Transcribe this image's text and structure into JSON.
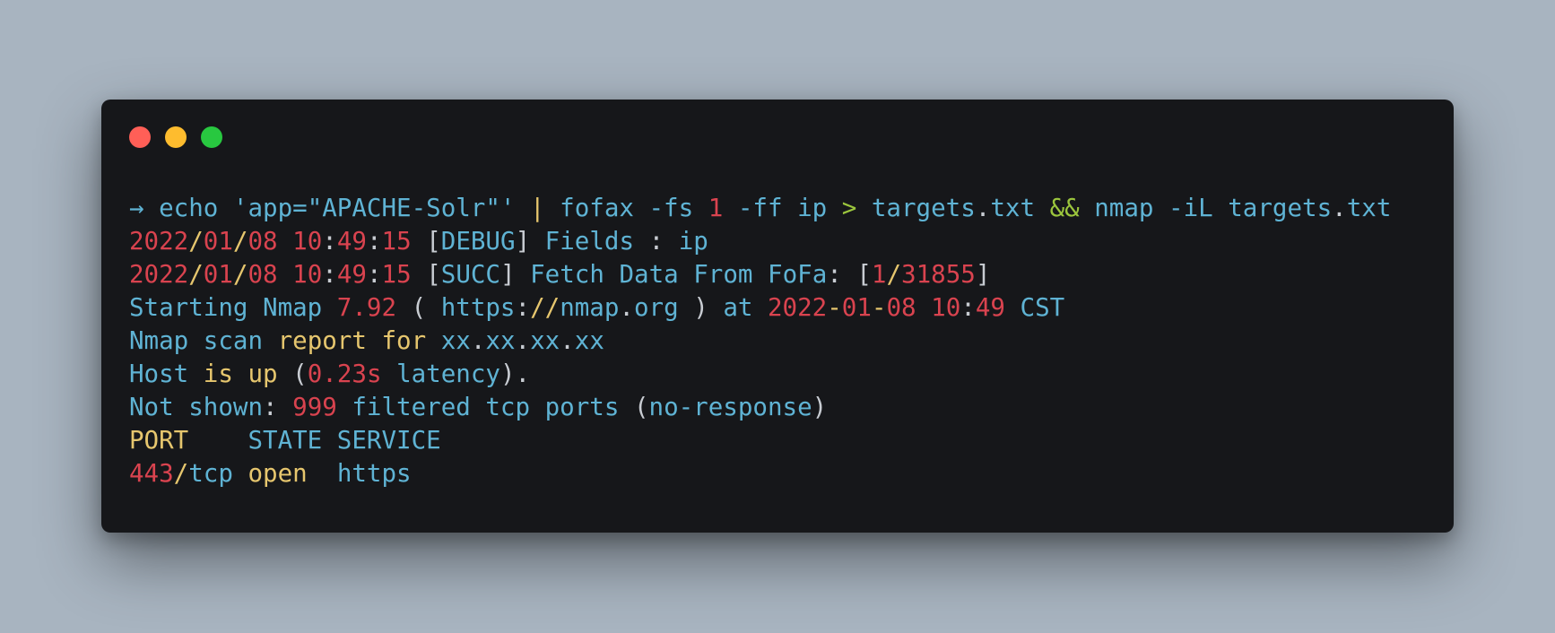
{
  "colors": {
    "blue": "#5fb3d4",
    "red": "#d9434f",
    "yellow": "#e6c66e",
    "white": "#c8ccd2",
    "green": "#9bc53d",
    "background": "#a8b4c0",
    "window": "#16171a"
  },
  "window_controls": {
    "close_icon": "red-dot",
    "minimize_icon": "yellow-dot",
    "maximize_icon": "green-dot"
  },
  "terminal": {
    "lines": [
      [
        {
          "t": "→",
          "c": "blue"
        },
        {
          "t": " echo ",
          "c": "blue"
        },
        {
          "t": "'app=\"APACHE-Solr\"'",
          "c": "blue"
        },
        {
          "t": " | ",
          "c": "yellow"
        },
        {
          "t": "fofax ",
          "c": "blue"
        },
        {
          "t": "-fs ",
          "c": "blue"
        },
        {
          "t": "1",
          "c": "red"
        },
        {
          "t": " -ff ip ",
          "c": "blue"
        },
        {
          "t": ">",
          "c": "green"
        },
        {
          "t": " targets",
          "c": "blue"
        },
        {
          "t": ".",
          "c": "white"
        },
        {
          "t": "txt ",
          "c": "blue"
        },
        {
          "t": "&&",
          "c": "green"
        },
        {
          "t": " nmap -iL targets",
          "c": "blue"
        },
        {
          "t": ".",
          "c": "white"
        },
        {
          "t": "txt",
          "c": "blue"
        }
      ],
      [
        {
          "t": "2022",
          "c": "red"
        },
        {
          "t": "/",
          "c": "yellow"
        },
        {
          "t": "01",
          "c": "red"
        },
        {
          "t": "/",
          "c": "yellow"
        },
        {
          "t": "08 10",
          "c": "red"
        },
        {
          "t": ":",
          "c": "white"
        },
        {
          "t": "49",
          "c": "red"
        },
        {
          "t": ":",
          "c": "white"
        },
        {
          "t": "15 ",
          "c": "red"
        },
        {
          "t": "[",
          "c": "white"
        },
        {
          "t": "DEBUG",
          "c": "blue"
        },
        {
          "t": "]",
          "c": "white"
        },
        {
          "t": " Fields ",
          "c": "blue"
        },
        {
          "t": ":",
          "c": "white"
        },
        {
          "t": " ip",
          "c": "blue"
        }
      ],
      [
        {
          "t": "2022",
          "c": "red"
        },
        {
          "t": "/",
          "c": "yellow"
        },
        {
          "t": "01",
          "c": "red"
        },
        {
          "t": "/",
          "c": "yellow"
        },
        {
          "t": "08 10",
          "c": "red"
        },
        {
          "t": ":",
          "c": "white"
        },
        {
          "t": "49",
          "c": "red"
        },
        {
          "t": ":",
          "c": "white"
        },
        {
          "t": "15 ",
          "c": "red"
        },
        {
          "t": "[",
          "c": "white"
        },
        {
          "t": "SUCC",
          "c": "blue"
        },
        {
          "t": "]",
          "c": "white"
        },
        {
          "t": " Fetch Data From FoFa",
          "c": "blue"
        },
        {
          "t": ": [",
          "c": "white"
        },
        {
          "t": "1",
          "c": "red"
        },
        {
          "t": "/",
          "c": "yellow"
        },
        {
          "t": "31855",
          "c": "red"
        },
        {
          "t": "]",
          "c": "white"
        }
      ],
      [
        {
          "t": "Starting Nmap ",
          "c": "blue"
        },
        {
          "t": "7.92",
          "c": "red"
        },
        {
          "t": " ( ",
          "c": "white"
        },
        {
          "t": "https",
          "c": "blue"
        },
        {
          "t": ":",
          "c": "white"
        },
        {
          "t": "//",
          "c": "yellow"
        },
        {
          "t": "nmap",
          "c": "blue"
        },
        {
          "t": ".",
          "c": "white"
        },
        {
          "t": "org",
          "c": "blue"
        },
        {
          "t": " ) ",
          "c": "white"
        },
        {
          "t": "at ",
          "c": "blue"
        },
        {
          "t": "2022",
          "c": "red"
        },
        {
          "t": "-",
          "c": "yellow"
        },
        {
          "t": "01",
          "c": "red"
        },
        {
          "t": "-",
          "c": "yellow"
        },
        {
          "t": "08 10",
          "c": "red"
        },
        {
          "t": ":",
          "c": "white"
        },
        {
          "t": "49",
          "c": "red"
        },
        {
          "t": " CST",
          "c": "blue"
        }
      ],
      [
        {
          "t": "Nmap scan ",
          "c": "blue"
        },
        {
          "t": "report for",
          "c": "yellow"
        },
        {
          "t": " xx",
          "c": "blue"
        },
        {
          "t": ".",
          "c": "white"
        },
        {
          "t": "xx",
          "c": "blue"
        },
        {
          "t": ".",
          "c": "white"
        },
        {
          "t": "xx",
          "c": "blue"
        },
        {
          "t": ".",
          "c": "white"
        },
        {
          "t": "xx",
          "c": "blue"
        }
      ],
      [
        {
          "t": "Host ",
          "c": "blue"
        },
        {
          "t": "is up",
          "c": "yellow"
        },
        {
          "t": " (",
          "c": "white"
        },
        {
          "t": "0.23s",
          "c": "red"
        },
        {
          "t": " latency",
          "c": "blue"
        },
        {
          "t": ").",
          "c": "white"
        }
      ],
      [
        {
          "t": "Not shown",
          "c": "blue"
        },
        {
          "t": ": ",
          "c": "white"
        },
        {
          "t": "999",
          "c": "red"
        },
        {
          "t": " filtered tcp ports ",
          "c": "blue"
        },
        {
          "t": "(",
          "c": "white"
        },
        {
          "t": "no-response",
          "c": "blue"
        },
        {
          "t": ")",
          "c": "white"
        }
      ],
      [
        {
          "t": "PORT",
          "c": "yellow"
        },
        {
          "t": "    STATE SERVICE",
          "c": "blue"
        }
      ],
      [
        {
          "t": "443",
          "c": "red"
        },
        {
          "t": "/",
          "c": "yellow"
        },
        {
          "t": "tcp ",
          "c": "blue"
        },
        {
          "t": "open",
          "c": "yellow"
        },
        {
          "t": "  https",
          "c": "blue"
        }
      ]
    ]
  }
}
